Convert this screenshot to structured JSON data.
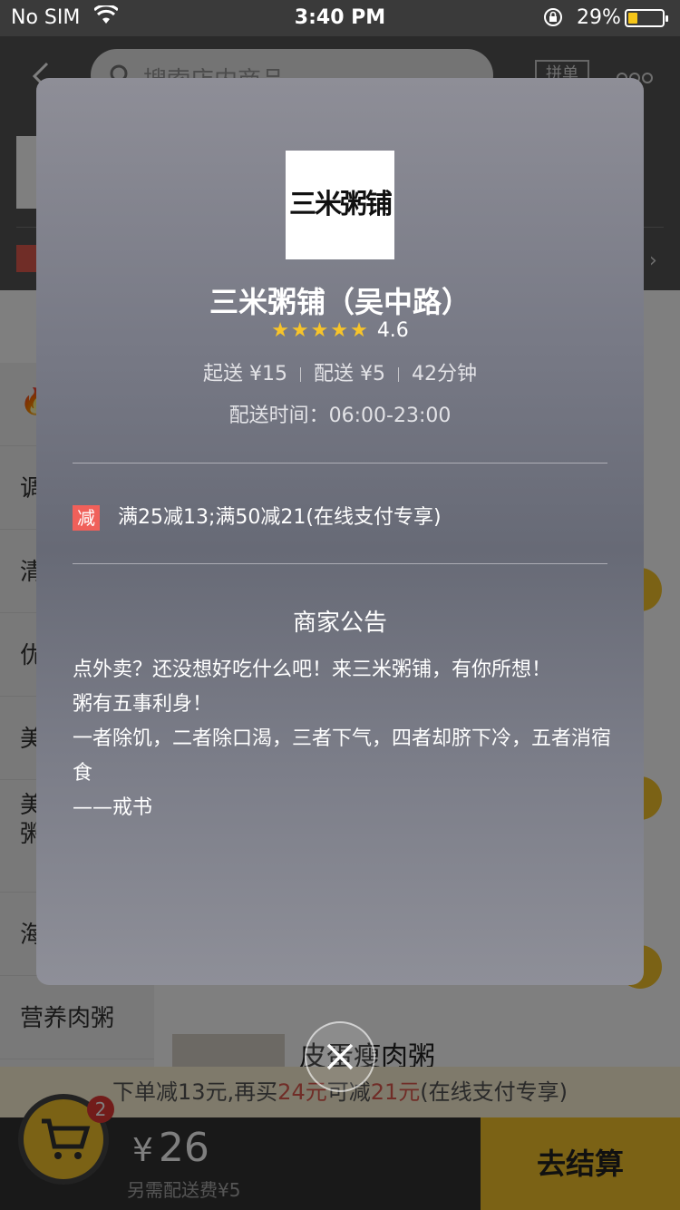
{
  "status_bar": {
    "carrier": "No SIM",
    "time": "3:40 PM",
    "battery_pct": "29%",
    "battery_level": 0.29
  },
  "header": {
    "search_placeholder": "搜索店内商品",
    "group_tag": "拼单"
  },
  "sidebar": {
    "items": [
      "调",
      "清",
      "优",
      "美",
      "美\n粥",
      "海",
      "营养肉粥"
    ]
  },
  "content": {
    "dish_name": "皮蛋瘦肉粥"
  },
  "promo_bar": {
    "prefix": "下单减13元,再买",
    "amount1": "24元",
    "middle": "可减",
    "amount2": "21元",
    "suffix": "(在线支付专享)"
  },
  "cart": {
    "badge_count": "2",
    "currency": "¥",
    "total": "26",
    "delivery_note": "另需配送费¥5",
    "checkout_label": "去结算"
  },
  "modal": {
    "logo_text": "三米粥铺",
    "store_name": "三米粥铺（吴中路）",
    "stars": 4.6,
    "stars_glyphs": "★★★★★",
    "rating": "4.6",
    "min_order": "起送 ¥15",
    "delivery_fee": "配送 ¥5",
    "delivery_time": "42分钟",
    "hours": "配送时间：06:00-23:00",
    "promo_badge": "减",
    "promo_text": "满25减13;满50减21(在线支付专享)",
    "notice_title": "商家公告",
    "notice_lines": [
      "点外卖？还没想好吃什么吧！来三米粥铺，有你所想！",
      "粥有五事利身！",
      "一者除饥，二者除口渴，三者下气，四者却脐下冷，五者消宿食",
      "——戒书"
    ]
  },
  "colors": {
    "accent": "#f7c42a",
    "promo_red": "#e05a4e",
    "cart_badge": "#e53935"
  }
}
